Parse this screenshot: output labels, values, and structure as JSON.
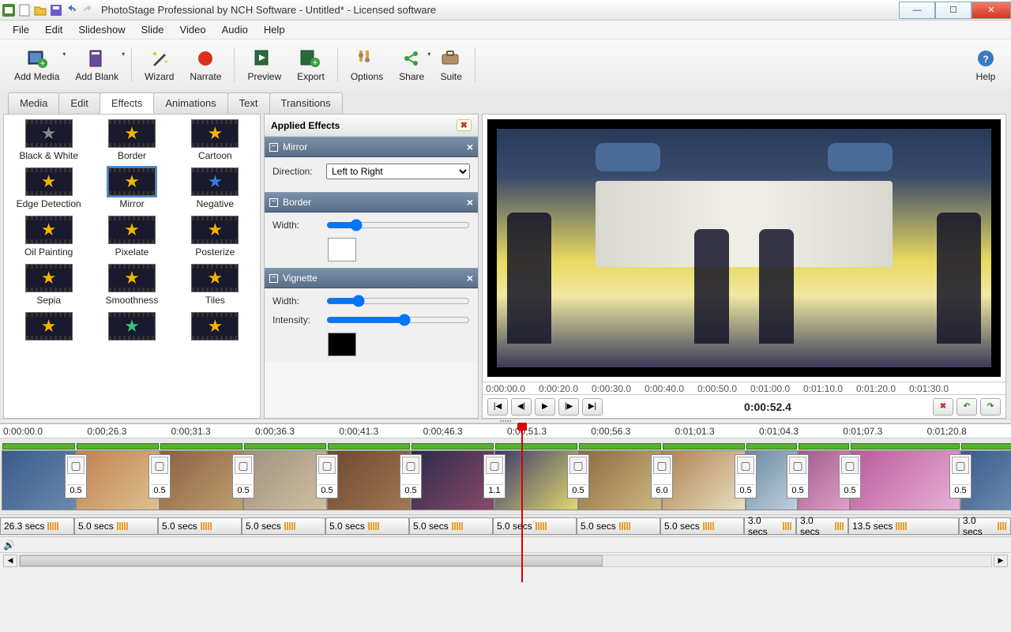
{
  "window": {
    "title": "PhotoStage Professional by NCH Software - Untitled* - Licensed software"
  },
  "menu": {
    "file": "File",
    "edit": "Edit",
    "slideshow": "Slideshow",
    "slide": "Slide",
    "video": "Video",
    "audio": "Audio",
    "help": "Help"
  },
  "toolbar": {
    "add_media": "Add Media",
    "add_blank": "Add Blank",
    "wizard": "Wizard",
    "narrate": "Narrate",
    "preview": "Preview",
    "export": "Export",
    "options": "Options",
    "share": "Share",
    "suite": "Suite",
    "help": "Help"
  },
  "tabs": {
    "media": "Media",
    "edit": "Edit",
    "effects": "Effects",
    "animations": "Animations",
    "text": "Text",
    "transitions": "Transitions"
  },
  "effects_grid": [
    "Black & White",
    "Border",
    "Cartoon",
    "Edge Detection",
    "Mirror",
    "Negative",
    "Oil Painting",
    "Pixelate",
    "Posterize",
    "Sepia",
    "Smoothness",
    "Tiles"
  ],
  "applied": {
    "title": "Applied Effects",
    "sections": {
      "mirror": {
        "name": "Mirror",
        "direction_label": "Direction:",
        "direction_value": "Left to Right"
      },
      "border": {
        "name": "Border",
        "width_label": "Width:"
      },
      "vignette": {
        "name": "Vignette",
        "width_label": "Width:",
        "intensity_label": "Intensity:"
      }
    }
  },
  "preview": {
    "ruler": [
      "0:00:00.0",
      "0:00:20.0",
      "0:00:30.0",
      "0:00:40.0",
      "0:00:50.0",
      "0:01:00.0",
      "0:01:10.0",
      "0:01:20.0",
      "0:01:30.0"
    ],
    "time": "0:00:52.4"
  },
  "timeline": {
    "ruler": [
      "0:00:00.0",
      "0:00;26.3",
      "0:00;31.3",
      "0:00;36.3",
      "0:00;41.3",
      "0:00;46.3",
      "0:00;51.3",
      "0:00;56.3",
      "0:01;01.3",
      "0:01;04.3",
      "0:01;07.3",
      "0:01;20.8"
    ],
    "transitions": [
      "0.5",
      "0.5",
      "0.5",
      "0.5",
      "0.5",
      "1.1",
      "0.5",
      "6.0",
      "0.5",
      "0.5",
      "0.5",
      "0.5"
    ],
    "audio": [
      "26.3 secs",
      "5.0 secs",
      "5.0 secs",
      "5.0 secs",
      "5.0 secs",
      "5.0 secs",
      "5.0 secs",
      "5.0 secs",
      "5.0 secs",
      "3.0 secs",
      "3.0 secs",
      "13.5 secs",
      "3.0 secs"
    ],
    "clip_w": [
      94,
      106,
      106,
      106,
      106,
      106,
      106,
      106,
      106,
      66,
      66,
      140,
      66
    ]
  }
}
